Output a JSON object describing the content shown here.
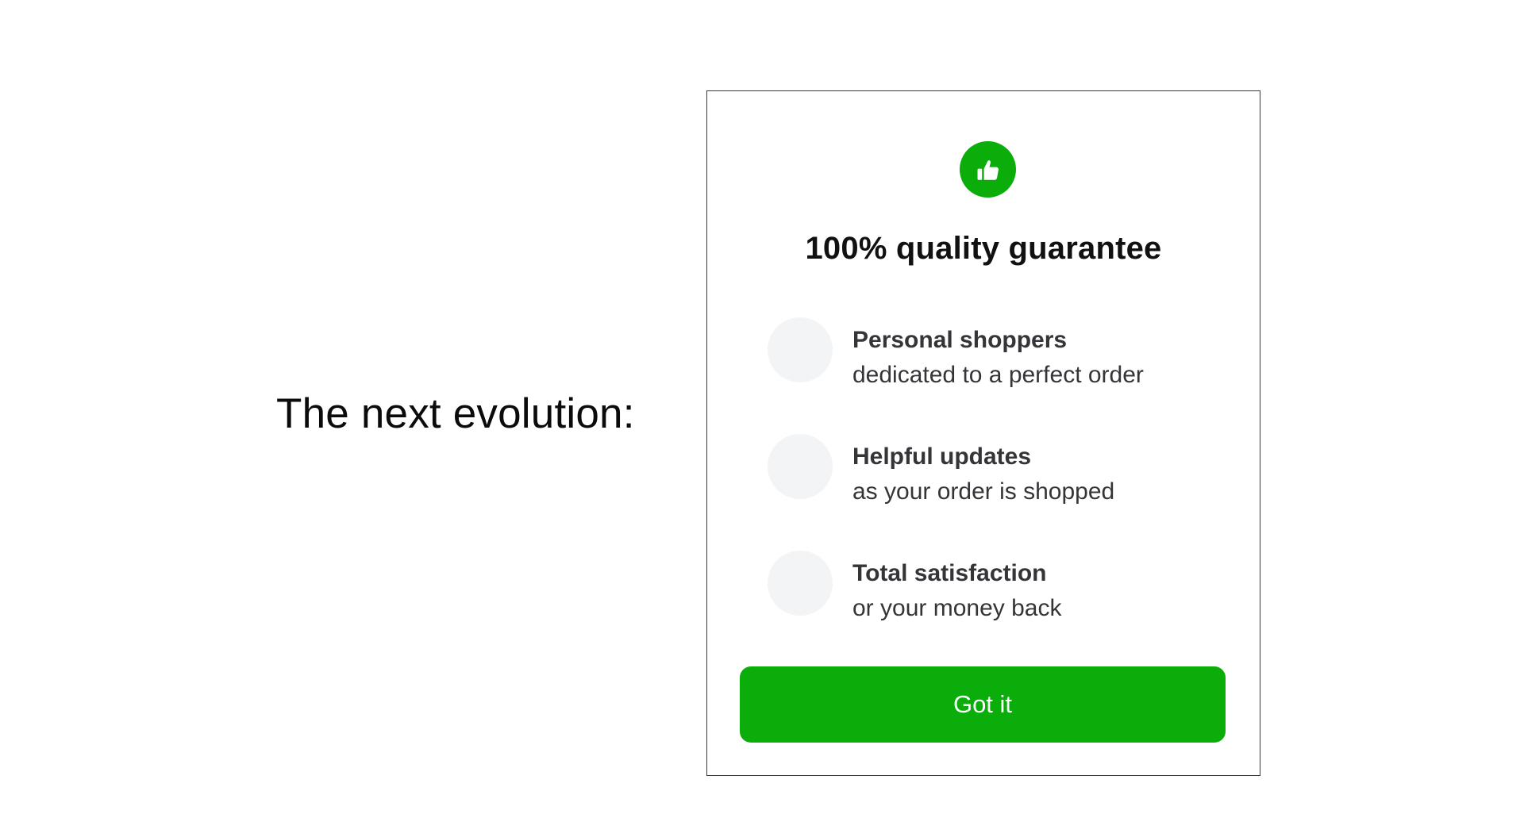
{
  "slide": {
    "heading": "The next evolution:"
  },
  "modal": {
    "icon": "thumbs-up-icon",
    "title": "100% quality guarantee",
    "features": [
      {
        "title": "Personal shoppers",
        "subtitle": "dedicated to a perfect order"
      },
      {
        "title": "Helpful updates",
        "subtitle": "as your order is shopped"
      },
      {
        "title": "Total satisfaction",
        "subtitle": "or your money back"
      }
    ],
    "button_label": "Got it"
  },
  "colors": {
    "accent": "#0AAD0A",
    "icon_placeholder": "#F3F4F6",
    "text": "#343538"
  }
}
